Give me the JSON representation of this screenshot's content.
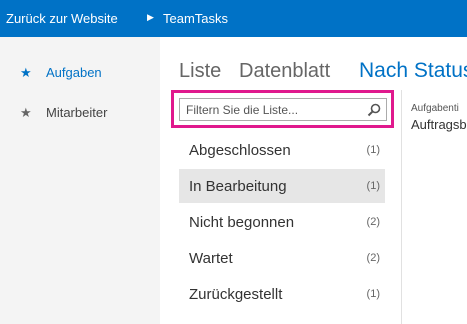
{
  "topbar": {
    "back_label": "Zurück zur Website",
    "site_title": "TeamTasks"
  },
  "nav": {
    "items": [
      {
        "label": "Aufgaben",
        "active": true
      },
      {
        "label": "Mitarbeiter",
        "active": false
      }
    ]
  },
  "views": {
    "tabs": [
      {
        "label": "Liste"
      },
      {
        "label": "Datenblatt"
      },
      {
        "label": "Nach Status"
      }
    ],
    "current": "Nach Status"
  },
  "search": {
    "placeholder": "Filtern Sie die Liste..."
  },
  "status_groups": [
    {
      "name": "Abgeschlossen",
      "count": "(1)"
    },
    {
      "name": "In Bearbeitung",
      "count": "(1)"
    },
    {
      "name": "Nicht begonnen",
      "count": "(2)"
    },
    {
      "name": "Wartet",
      "count": "(2)"
    },
    {
      "name": "Zurückgestellt",
      "count": "(1)"
    }
  ],
  "selected_status": "In Bearbeitung",
  "detail": {
    "column_header": "Aufgabenti",
    "first_value": "Auftragsb"
  },
  "colors": {
    "accent": "#0072c6",
    "highlight": "#e0198d",
    "nav_bg": "#f4f4f4",
    "selected_row": "#e6e6e6"
  }
}
